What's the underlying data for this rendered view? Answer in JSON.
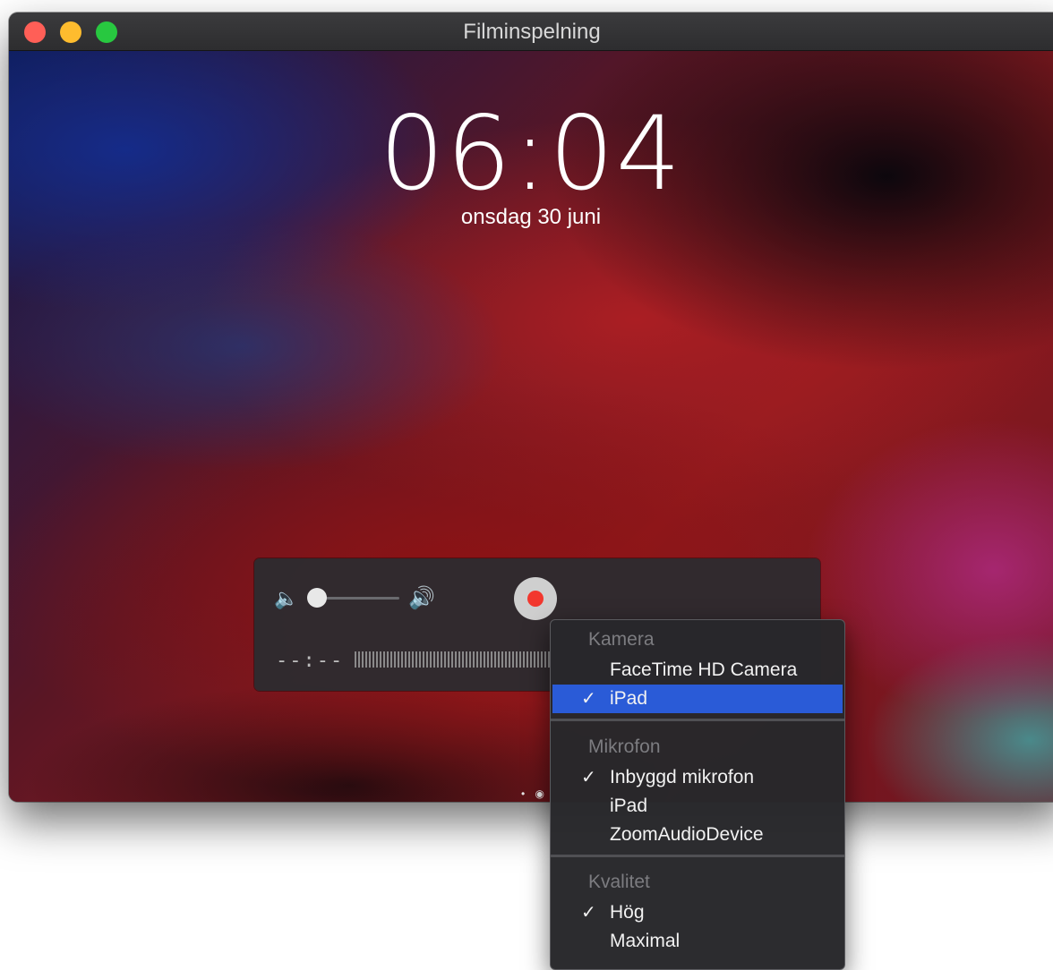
{
  "window": {
    "title": "Filminspelning",
    "controls": [
      "close",
      "minimize",
      "zoom"
    ]
  },
  "lock_screen": {
    "time": "06:04",
    "date": "onsdag 30 juni",
    "page_indicator": "• ◉"
  },
  "controls": {
    "volume_low_icon": "🔈",
    "volume_high_icon": "🔊",
    "volume_level": 0.0,
    "time_readout": "--:--",
    "record_color": "#f2372e"
  },
  "menu": {
    "sections": [
      {
        "header": "Kamera",
        "items": [
          {
            "label": "FaceTime HD Camera",
            "checked": false
          },
          {
            "label": "iPad",
            "checked": true,
            "selected": true
          }
        ]
      },
      {
        "header": "Mikrofon",
        "items": [
          {
            "label": "Inbyggd mikrofon",
            "checked": true
          },
          {
            "label": "iPad",
            "checked": false
          },
          {
            "label": "ZoomAudioDevice",
            "checked": false
          }
        ]
      },
      {
        "header": "Kvalitet",
        "items": [
          {
            "label": "Hög",
            "checked": true
          },
          {
            "label": "Maximal",
            "checked": false
          }
        ]
      }
    ],
    "check_glyph": "✓",
    "highlight_color": "#2a5bd7"
  }
}
